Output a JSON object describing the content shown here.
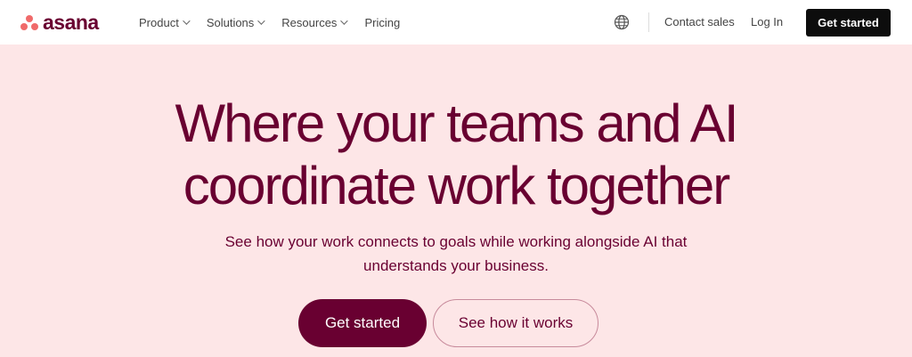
{
  "brand": {
    "name": "asana",
    "logo_icon": "asana-three-dots-logo",
    "logo_color": "#f06a6a",
    "text_color": "#690031"
  },
  "nav": {
    "items": [
      {
        "label": "Product",
        "has_dropdown": true
      },
      {
        "label": "Solutions",
        "has_dropdown": true
      },
      {
        "label": "Resources",
        "has_dropdown": true
      },
      {
        "label": "Pricing",
        "has_dropdown": false
      }
    ],
    "globe_icon": "globe-icon",
    "contact_label": "Contact sales",
    "login_label": "Log In",
    "cta_label": "Get started"
  },
  "hero": {
    "title_line1": "Where your teams and AI",
    "title_line2": "coordinate work together",
    "subtitle_line1": "See how your work connects to goals while working alongside AI that",
    "subtitle_line2": "understands your business.",
    "primary_cta": "Get started",
    "secondary_cta": "See how it works"
  },
  "colors": {
    "hero_background": "#fde6e7",
    "accent": "#690031",
    "nav_cta_background": "#0d0d0d"
  }
}
